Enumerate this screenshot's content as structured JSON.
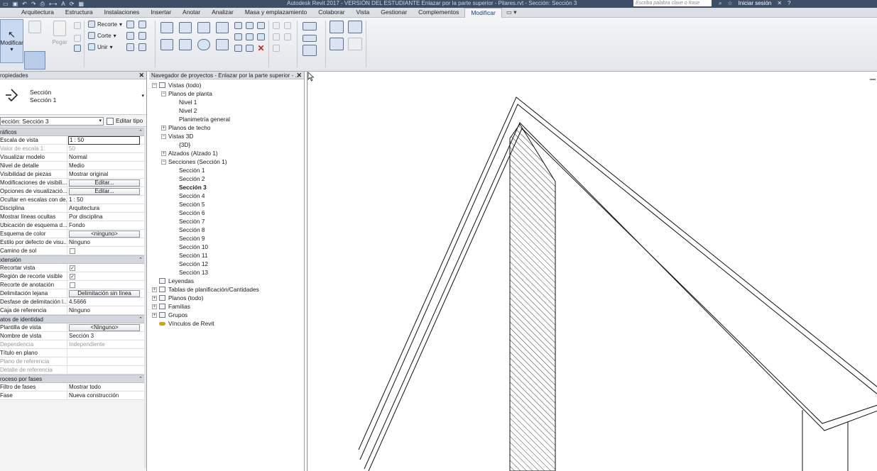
{
  "titlebar": {
    "title": "Autodesk Revit 2017 - VERSIÓN DEL ESTUDIANTE    Enlazar por la parte superior - Pilares.rvt - Sección: Sección 3",
    "search_placeholder": "Escriba palabra clave o frase",
    "signin": "Iniciar sesión"
  },
  "menu": {
    "tabs": [
      "Arquitectura",
      "Estructura",
      "Instalaciones",
      "Insertar",
      "Anotar",
      "Analizar",
      "Masa y emplazamiento",
      "Colaborar",
      "Vista",
      "Gestionar",
      "Complementos",
      "Modificar"
    ],
    "active": "Modificar",
    "extra": "▭ ▾"
  },
  "ribbon": {
    "modify_label": "Modificar",
    "paste_label": "Pegar",
    "trim_label": "Recorte",
    "cut_label": "Corte",
    "join_label": "Unir"
  },
  "properties": {
    "panel_title": "ropiedades",
    "type_family": "Sección",
    "type_name": "Sección 1",
    "instance_selector": "ección: Sección 3",
    "edit_type": "Editar tipo",
    "groups": {
      "graphics": "ráficos",
      "extents": "xtensión",
      "identity": "atos de identidad",
      "phasing": "roceso por fases"
    },
    "graphics_rows": [
      {
        "k": "Escala de vista",
        "v": "1 : 50"
      },
      {
        "k": "Valor de escala    1:",
        "v": "50"
      },
      {
        "k": "Visualizar modelo",
        "v": "Normal"
      },
      {
        "k": "Nivel de detalle",
        "v": "Medio"
      },
      {
        "k": "Visibilidad de piezas",
        "v": "Mostrar original"
      },
      {
        "k": "Modificaciones de visibili...",
        "v": "Editar..."
      },
      {
        "k": "Opciones de visualizació...",
        "v": "Editar..."
      },
      {
        "k": "Ocultar en escalas con de...",
        "v": "1 : 50"
      },
      {
        "k": "Disciplina",
        "v": "Arquitectura"
      },
      {
        "k": "Mostrar líneas ocultas",
        "v": "Por disciplina"
      },
      {
        "k": "Ubicación de esquema d...",
        "v": "Fondo"
      },
      {
        "k": "Esquema de color",
        "v": "<ninguno>"
      },
      {
        "k": "Estilo por defecto de visu...",
        "v": "Ninguno"
      },
      {
        "k": "Camino de sol",
        "v": ""
      }
    ],
    "extents_rows": [
      {
        "k": "Recortar vista",
        "v": "✓"
      },
      {
        "k": "Región de recorte visible",
        "v": "✓"
      },
      {
        "k": "Recorte de anotación",
        "v": ""
      },
      {
        "k": "Delimitación lejana",
        "v": "Delimitación sin línea"
      },
      {
        "k": "Desfase de delimitación l...",
        "v": "4.5666"
      },
      {
        "k": "Caja de referencia",
        "v": "Ninguno"
      }
    ],
    "identity_rows": [
      {
        "k": "Plantilla de vista",
        "v": "<Ninguno>"
      },
      {
        "k": "Nombre de vista",
        "v": "Sección 3"
      },
      {
        "k": "Dependencia",
        "v": "Independiente"
      },
      {
        "k": "Título en plano",
        "v": ""
      },
      {
        "k": "Plano de referencia",
        "v": ""
      },
      {
        "k": "Detalle de referencia",
        "v": ""
      }
    ],
    "phasing_rows": [
      {
        "k": "Filtro de fases",
        "v": "Mostrar todo"
      },
      {
        "k": "Fase",
        "v": "Nueva construcción"
      }
    ]
  },
  "browser": {
    "panel_title": "Navegador de proyectos - Enlazar por la parte superior - ...",
    "nodes": [
      {
        "label": "Vistas (todo)",
        "expander": "−",
        "icon": true
      },
      {
        "label": "Planos de planta",
        "expander": "−",
        "icon": false
      },
      {
        "label": "Nivel 1",
        "expander": "",
        "icon": false
      },
      {
        "label": "Nivel 2",
        "expander": "",
        "icon": false
      },
      {
        "label": "Planimetría general",
        "expander": "",
        "icon": false
      },
      {
        "label": "Planos de techo",
        "expander": "+",
        "icon": false
      },
      {
        "label": "Vistas 3D",
        "expander": "−",
        "icon": false
      },
      {
        "label": "{3D}",
        "expander": "",
        "icon": false
      },
      {
        "label": "Alzados (Alzado 1)",
        "expander": "+",
        "icon": false
      },
      {
        "label": "Secciones (Sección 1)",
        "expander": "−",
        "icon": false
      },
      {
        "label": "Sección 1",
        "expander": "",
        "icon": false
      },
      {
        "label": "Sección 2",
        "expander": "",
        "icon": false
      },
      {
        "label": "Sección 3",
        "expander": "",
        "icon": false,
        "bold": true
      },
      {
        "label": "Sección 4",
        "expander": "",
        "icon": false
      },
      {
        "label": "Sección 5",
        "expander": "",
        "icon": false
      },
      {
        "label": "Sección 6",
        "expander": "",
        "icon": false
      },
      {
        "label": "Sección 7",
        "expander": "",
        "icon": false
      },
      {
        "label": "Sección 8",
        "expander": "",
        "icon": false
      },
      {
        "label": "Sección 9",
        "expander": "",
        "icon": false
      },
      {
        "label": "Sección 10",
        "expander": "",
        "icon": false
      },
      {
        "label": "Sección 11",
        "expander": "",
        "icon": false
      },
      {
        "label": "Sección 12",
        "expander": "",
        "icon": false
      },
      {
        "label": "Sección 13",
        "expander": "",
        "icon": false
      },
      {
        "label": "Leyendas",
        "expander": "",
        "icon": true
      },
      {
        "label": "Tablas de planificación/Cantidades",
        "expander": "+",
        "icon": true
      },
      {
        "label": "Planos (todo)",
        "expander": "+",
        "icon": true
      },
      {
        "label": "Familias",
        "expander": "+",
        "icon": true
      },
      {
        "label": "Grupos",
        "expander": "+",
        "icon": true
      },
      {
        "label": "Vínculos de Revit",
        "expander": "",
        "icon": true,
        "link": true
      }
    ]
  },
  "colors": {
    "titlebar": "#3c4f66",
    "active_tab_text": "#1a3e7a",
    "hatch": "#222222"
  }
}
